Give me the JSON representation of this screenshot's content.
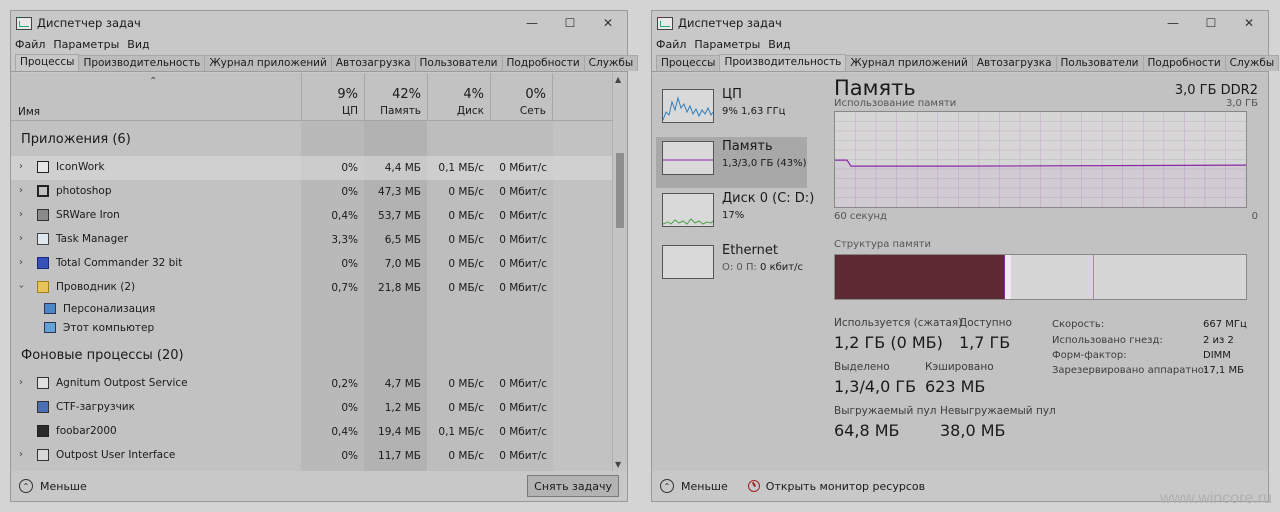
{
  "window_left": {
    "title": "Диспетчер задач",
    "menu": [
      "Файл",
      "Параметры",
      "Вид"
    ],
    "tabs": [
      "Процессы",
      "Производительность",
      "Журнал приложений",
      "Автозагрузка",
      "Пользователи",
      "Подробности",
      "Службы"
    ],
    "columns": {
      "name": "Имя",
      "cpu": {
        "pct": "9%",
        "label": "ЦП"
      },
      "mem": {
        "pct": "42%",
        "label": "Память"
      },
      "disk": {
        "pct": "4%",
        "label": "Диск"
      },
      "net": {
        "pct": "0%",
        "label": "Сеть"
      }
    },
    "apps_header": "Приложения (6)",
    "apps": [
      {
        "name": "IconWork",
        "cpu": "0%",
        "mem": "4,4 МБ",
        "disk": "0,1 МБ/с",
        "net": "0 Мбит/с"
      },
      {
        "name": "photoshop",
        "cpu": "0%",
        "mem": "47,3 МБ",
        "disk": "0 МБ/с",
        "net": "0 Мбит/с"
      },
      {
        "name": "SRWare Iron",
        "cpu": "0,4%",
        "mem": "53,7 МБ",
        "disk": "0 МБ/с",
        "net": "0 Мбит/с"
      },
      {
        "name": "Task Manager",
        "cpu": "3,3%",
        "mem": "6,5 МБ",
        "disk": "0 МБ/с",
        "net": "0 Мбит/с"
      },
      {
        "name": "Total Commander 32 bit",
        "cpu": "0%",
        "mem": "7,0 МБ",
        "disk": "0 МБ/с",
        "net": "0 Мбит/с"
      },
      {
        "name": "Проводник (2)",
        "cpu": "0,7%",
        "mem": "21,8 МБ",
        "disk": "0 МБ/с",
        "net": "0 Мбит/с"
      }
    ],
    "explorer_children": [
      "Персонализация",
      "Этот компьютер"
    ],
    "bg_header": "Фоновые процессы (20)",
    "bg": [
      {
        "name": "Agnitum Outpost Service",
        "cpu": "0,2%",
        "mem": "4,7 МБ",
        "disk": "0 МБ/с",
        "net": "0 Мбит/с"
      },
      {
        "name": "CTF-загрузчик",
        "cpu": "0%",
        "mem": "1,2 МБ",
        "disk": "0 МБ/с",
        "net": "0 Мбит/с"
      },
      {
        "name": "foobar2000",
        "cpu": "0,4%",
        "mem": "19,4 МБ",
        "disk": "0,1 МБ/с",
        "net": "0 Мбит/с"
      },
      {
        "name": "Outpost User Interface",
        "cpu": "0%",
        "mem": "11,7 МБ",
        "disk": "0 МБ/с",
        "net": "0 Мбит/с"
      }
    ],
    "footer_less": "Меньше",
    "end_task": "Снять задачу"
  },
  "window_right": {
    "title": "Диспетчер задач",
    "menu": [
      "Файл",
      "Параметры",
      "Вид"
    ],
    "tabs": [
      "Процессы",
      "Производительность",
      "Журнал приложений",
      "Автозагрузка",
      "Пользователи",
      "Подробности",
      "Службы"
    ],
    "left_items": [
      {
        "title": "ЦП",
        "sub": "9% 1,63 ГГц"
      },
      {
        "title": "Память",
        "sub": "1,3/3,0 ГБ (43%)"
      },
      {
        "title": "Диск 0 (C: D:)",
        "sub": "17%"
      },
      {
        "title": "Ethernet",
        "sub_prefix": "О: 0 П: ",
        "sub_value": "0 кбит/с"
      }
    ],
    "memory": {
      "title": "Память",
      "capacity": "3,0 ГБ DDR2",
      "usage_label": "Использование памяти",
      "usage_max": "3,0 ГБ",
      "axis_left": "60 секунд",
      "axis_right": "0",
      "composition_label": "Структура памяти",
      "usage_fraction": 0.43,
      "stats": {
        "in_use_label": "Используется (сжатая)",
        "in_use": "1,2 ГБ (0 МБ)",
        "available_label": "Доступно",
        "available": "1,7 ГБ",
        "committed_label": "Выделено",
        "committed": "1,3/4,0 ГБ",
        "cached_label": "Кэшировано",
        "cached": "623 МБ",
        "paged_label": "Выгружаемый пул",
        "paged": "64,8 МБ",
        "nonpaged_label": "Невыгружаемый пул",
        "nonpaged": "38,0 МБ"
      },
      "specs": [
        {
          "k": "Скорость:",
          "v": "667 МГц"
        },
        {
          "k": "Использовано гнезд:",
          "v": "2 из 2"
        },
        {
          "k": "Форм-фактор:",
          "v": "DIMM"
        },
        {
          "k": "Зарезервировано аппаратно:",
          "v": "17,1 МБ"
        }
      ]
    },
    "footer_less": "Меньше",
    "footer_monitor": "Открыть монитор ресурсов"
  },
  "watermark": "www.wincore.ru",
  "colors": {
    "mem_line": "#8b28a8",
    "in_use": "#5c2a30",
    "cpu_graph": "#2f7fc0",
    "disk_graph": "#4ca04c"
  }
}
